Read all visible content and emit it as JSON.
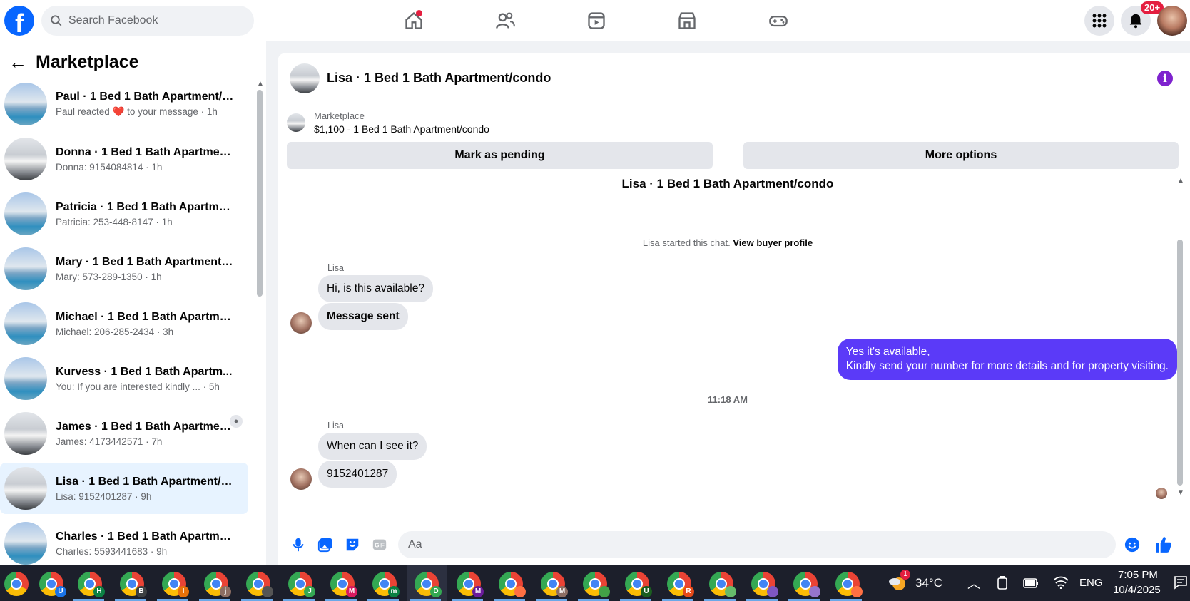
{
  "topbar": {
    "search_placeholder": "Search Facebook",
    "notification_badge": "20+",
    "accent_color": "#0866ff"
  },
  "sidebar": {
    "title": "Marketplace",
    "conversations": [
      {
        "title": "Paul · 1 Bed 1 Bath Apartment/c...",
        "preview": "Paul reacted ❤️ to your message · 1h"
      },
      {
        "title": "Donna · 1 Bed 1 Bath Apartment...",
        "preview": "Donna: 9154084814 · 1h"
      },
      {
        "title": "Patricia · 1 Bed 1 Bath Apartmen...",
        "preview": "Patricia: 253-448-8147 · 1h"
      },
      {
        "title": "Mary · 1 Bed 1 Bath Apartment/c...",
        "preview": "Mary: 573-289-1350 · 1h"
      },
      {
        "title": "Michael · 1 Bed 1 Bath Apartmen...",
        "preview": "Michael: 206-285-2434 · 3h"
      },
      {
        "title": "Kurvess · 1 Bed 1 Bath Apartm...",
        "preview": "You: If you are interested kindly ... · 5h"
      },
      {
        "title": "James · 1 Bed 1 Bath Apartment/...",
        "preview": "James: 4173442571 · 7h"
      },
      {
        "title": "Lisa · 1 Bed 1 Bath Apartment/co...",
        "preview": "Lisa: 9152401287 · 9h"
      },
      {
        "title": "Charles · 1 Bed 1 Bath Apartmen...",
        "preview": "Charles: 5593441683 · 9h"
      }
    ]
  },
  "chat": {
    "header_title": "Lisa · 1 Bed 1 Bath Apartment/condo",
    "marketplace_label": "Marketplace",
    "listing": "$1,100 - 1 Bed 1 Bath Apartment/condo",
    "mark_pending": "Mark as pending",
    "more_options": "More options",
    "thread_title": "Lisa · 1 Bed 1 Bath Apartment/condo",
    "started_text": "Lisa started this chat.",
    "view_profile": "View buyer profile",
    "sender_name": "Lisa",
    "msg1": "Hi, is this available?",
    "msg2": "Message sent",
    "my_msg_line1": "Yes it's available,",
    "my_msg_line2": "Kindly send your number for more details and for property visiting.",
    "timestamp": "11:18 AM",
    "sender_name2": "Lisa",
    "msg3": "When can I see it?",
    "msg4": "9152401287",
    "composer_placeholder": "Aa"
  },
  "taskbar": {
    "apps": [
      "",
      "U",
      "H",
      "B",
      "I",
      "j",
      "",
      "J",
      "M",
      "m",
      "D",
      "M",
      "",
      "M",
      "",
      "U",
      "R",
      "",
      "",
      "",
      ""
    ],
    "weather": "34°C",
    "language": "ENG",
    "time": "7:05 PM",
    "date": "10/4/2025",
    "weather_badge": "1"
  }
}
